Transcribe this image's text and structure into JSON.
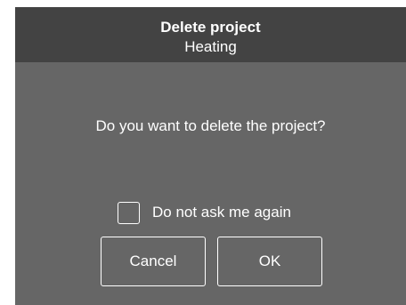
{
  "dialog": {
    "title": "Delete project",
    "subtitle": "Heating",
    "message": "Do you want to delete the project?",
    "checkbox": {
      "label": "Do not ask me again",
      "checked": false
    },
    "buttons": {
      "cancel_label": "Cancel",
      "ok_label": "OK"
    }
  },
  "colors": {
    "header_bg": "#434343",
    "body_bg": "#666666",
    "text": "#ffffff"
  }
}
